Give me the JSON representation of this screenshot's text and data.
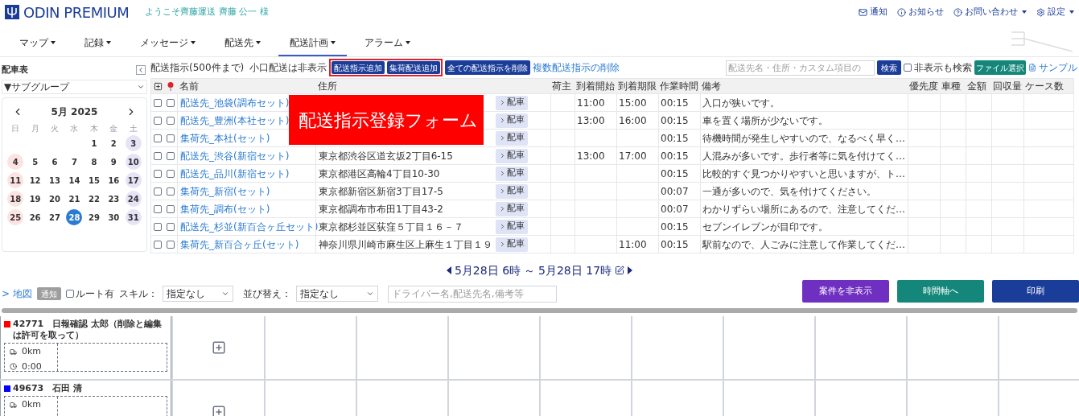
{
  "header": {
    "logo": "ODIN PREMIUM",
    "welcome": "ようこそ齊藤運送 齊藤 公一 様",
    "links": [
      {
        "kind": "mail",
        "label": "通知",
        "dropdown": false
      },
      {
        "kind": "info",
        "label": "お知らせ",
        "dropdown": false
      },
      {
        "kind": "help",
        "label": "お問い合わせ",
        "dropdown": true
      },
      {
        "kind": "gear",
        "label": "設定",
        "dropdown": true
      }
    ]
  },
  "nav": [
    {
      "label": "マップ",
      "selected": false
    },
    {
      "label": "記録",
      "selected": false
    },
    {
      "label": "メッセージ",
      "selected": false
    },
    {
      "label": "配送先",
      "selected": false
    },
    {
      "label": "配送計画",
      "selected": true
    },
    {
      "label": "アラーム",
      "selected": false
    }
  ],
  "sidebar": {
    "title": "配車表",
    "subgroup": "▼サブグループ",
    "calendar": {
      "month": "5月 2025",
      "weekdays": [
        "日",
        "月",
        "火",
        "水",
        "木",
        "金",
        "土"
      ],
      "weeks": [
        [
          {
            "day": "1",
            "selected": false
          },
          {
            "day": "2",
            "selected": false
          },
          {
            "day": "3",
            "selected": false
          }
        ],
        [
          {
            "day": "4",
            "selected": false
          },
          {
            "day": "5",
            "selected": false
          },
          {
            "day": "6",
            "selected": false
          },
          {
            "day": "7",
            "selected": false
          },
          {
            "day": "8",
            "selected": false
          },
          {
            "day": "9",
            "selected": false
          },
          {
            "day": "10",
            "selected": false
          }
        ],
        [
          {
            "day": "11",
            "selected": false
          },
          {
            "day": "12",
            "selected": false
          },
          {
            "day": "13",
            "selected": false
          },
          {
            "day": "14",
            "selected": false
          },
          {
            "day": "15",
            "selected": false
          },
          {
            "day": "16",
            "selected": false
          },
          {
            "day": "17",
            "selected": false
          }
        ],
        [
          {
            "day": "18",
            "selected": false
          },
          {
            "day": "19",
            "selected": false
          },
          {
            "day": "20",
            "selected": false
          },
          {
            "day": "21",
            "selected": false
          },
          {
            "day": "22",
            "selected": false
          },
          {
            "day": "23",
            "selected": false
          },
          {
            "day": "24",
            "selected": false
          }
        ],
        [
          {
            "day": "25",
            "selected": false
          },
          {
            "day": "26",
            "selected": false
          },
          {
            "day": "27",
            "selected": false
          },
          {
            "day": "28",
            "selected": true
          },
          {
            "day": "29",
            "selected": false
          },
          {
            "day": "30",
            "selected": false
          },
          {
            "day": "31",
            "selected": false
          }
        ]
      ]
    }
  },
  "toolbar": {
    "label": "配送指示(500件まで)",
    "note": "小口配送は非表示",
    "highlighted_buttons": [
      "配送指示追加",
      "集荷配送追加"
    ],
    "delete_all": "全ての配送指示を削除",
    "delete_multi": "複数配送指示の削除",
    "search_placeholder": "配送先名・住所・カスタム項目の",
    "search_button": "検索",
    "hidden_search": {
      "label": "非表示も検索",
      "checked": false
    },
    "file_button": "ファイル選択",
    "sample": "サンプル"
  },
  "callout": "配送指示登録フォーム",
  "table": {
    "columns": [
      "名前",
      "住所",
      "荷主",
      "到着開始",
      "到着期限",
      "作業時間",
      "備考",
      "優先度",
      "車種",
      "金額",
      "回収量",
      "ケース数"
    ],
    "rows": [
      {
        "name": "配送先_池袋(調布セット)",
        "button": "配車",
        "start": "11:00",
        "end": "15:00",
        "work": "00:15",
        "note": "入口が狭いです。",
        "checked": false,
        "pinned": false
      },
      {
        "name": "配送先_豊洲(本社セット)",
        "button": "配車",
        "start": "13:00",
        "end": "16:00",
        "work": "00:15",
        "note": "車を置く場所が少ないです。",
        "checked": false,
        "pinned": false
      },
      {
        "name": "集荷先_本社(セット)",
        "button": "配車",
        "work": "00:15",
        "note": "待機時間が発生しやすいので、なるべく早く…",
        "checked": false,
        "pinned": false
      },
      {
        "name": "配送先_渋谷(新宿セット)",
        "address": "東京都渋谷区道玄坂2丁目6-15",
        "button": "配車",
        "start": "13:00",
        "end": "17:00",
        "work": "00:15",
        "note": "人混みが多いです。歩行者等に気を付けてく…",
        "checked": false,
        "pinned": false
      },
      {
        "name": "配送先_品川(新宿セット)",
        "address": "東京都港区高輪4丁目10-30",
        "button": "配車",
        "work": "00:15",
        "note": "比較的すぐ見つかりやすいと思いますが、ト…",
        "checked": false,
        "pinned": false
      },
      {
        "name": "集荷先_新宿(セット)",
        "address": "東京都新宿区新宿3丁目17-5",
        "button": "配車",
        "work": "00:07",
        "note": "一通が多いので、気を付けてください。",
        "checked": false,
        "pinned": false
      },
      {
        "name": "集荷先_調布(セット)",
        "address": "東京都調布市布田1丁目43-2",
        "button": "配車",
        "work": "00:07",
        "note": "わかりずらい場所にあるので、注意してくだ…",
        "checked": false,
        "pinned": false
      },
      {
        "name": "配送先_杉並(新百合ヶ丘セット)",
        "address": "東京都杉並区荻窪５丁目１６－７",
        "button": "配車",
        "work": "00:15",
        "note": "セブンイレブンが目印です。",
        "checked": false,
        "pinned": false
      },
      {
        "name": "集荷先_新百合ヶ丘(セット)",
        "address": "神奈川県川崎市麻生区上麻生１丁目１９",
        "button": "配車",
        "end": "11:00",
        "work": "00:15",
        "note": "駅前なので、人ごみに注意して作業してくだ…",
        "checked": false,
        "pinned": false
      }
    ]
  },
  "range": {
    "from": "5月28日 6時",
    "separator": "～",
    "to": "5月28日 17時"
  },
  "filters": {
    "map_link": "> 地図",
    "notify": "通知",
    "route": {
      "label": "ルート有",
      "checked": false
    },
    "skill_label": "スキル：",
    "skill": "指定なし",
    "sort_label": "並び替え：",
    "sort": "指定なし",
    "driver_placeholder": "ドライバー名,配送先名,備考等"
  },
  "actions": [
    {
      "kind": "purple",
      "label": "案件を非表示"
    },
    {
      "kind": "teal",
      "label": "時間軸へ"
    },
    {
      "kind": "navy",
      "label": "印刷"
    }
  ],
  "drivers": [
    {
      "color": "#ff0000",
      "id": "42771",
      "name": "日報確認 太郎（削除と編集は許可を取って）",
      "distance": "0km",
      "time": "0:00"
    },
    {
      "color": "#0000ff",
      "id": "49673",
      "name": "石田 清",
      "distance": "0km"
    }
  ]
}
